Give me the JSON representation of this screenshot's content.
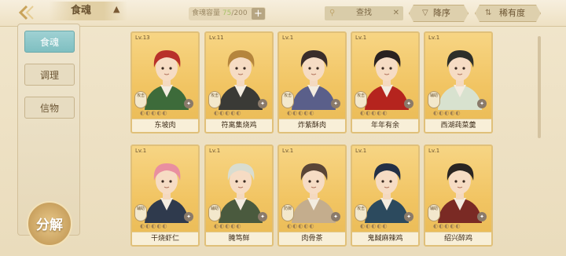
{
  "header": {
    "back_icon": "chevron-left-icon",
    "title": "食魂",
    "capacity_label": "食魂容量",
    "capacity_current": "75",
    "capacity_max": "/200",
    "plus": "+",
    "search_placeholder": "查找",
    "clear": "✕",
    "sort_desc": "降序",
    "sort_rarity": "稀有度"
  },
  "sidebar": {
    "tabs": [
      {
        "label": "食魂",
        "active": true
      },
      {
        "label": "调理",
        "active": false
      },
      {
        "label": "信物",
        "active": false
      }
    ],
    "decompose": "分解"
  },
  "cards": [
    {
      "level": "Lv.13",
      "name": "东坡肉",
      "hair": "#b8302a",
      "coat": "#3d6b3a",
      "badge": "攻击"
    },
    {
      "level": "Lv.11",
      "name": "符离集烧鸡",
      "hair": "#b5853d",
      "coat": "#3a3a36",
      "badge": "攻击"
    },
    {
      "level": "Lv.1",
      "name": "炸紫酥肉",
      "hair": "#3a2d2a",
      "coat": "#5a5f8a",
      "badge": "攻击"
    },
    {
      "level": "Lv.1",
      "name": "年年有余",
      "hair": "#2a2220",
      "coat": "#b5241e",
      "badge": "攻击"
    },
    {
      "level": "Lv.1",
      "name": "西湖莼菜羹",
      "hair": "#2d2f2a",
      "coat": "#d8e2cf",
      "badge": "辅助"
    },
    {
      "level": "Lv.1",
      "name": "干烧虾仁",
      "hair": "#e98fa0",
      "coat": "#2f3a4d",
      "badge": "辅助"
    },
    {
      "level": "Lv.1",
      "name": "腌笃鲜",
      "hair": "#d9ddd0",
      "coat": "#4a5a3e",
      "badge": "辅助"
    },
    {
      "level": "Lv.1",
      "name": "肉骨茶",
      "hair": "#5a4536",
      "coat": "#c4ad8d",
      "badge": "防御"
    },
    {
      "level": "Lv.1",
      "name": "鬼馘麻辣鸡",
      "hair": "#233046",
      "coat": "#2c4a5e",
      "badge": "攻击"
    },
    {
      "level": "Lv.1",
      "name": "绍兴醉鸡",
      "hair": "#2a2522",
      "coat": "#7a2a24",
      "badge": "辅助"
    }
  ]
}
